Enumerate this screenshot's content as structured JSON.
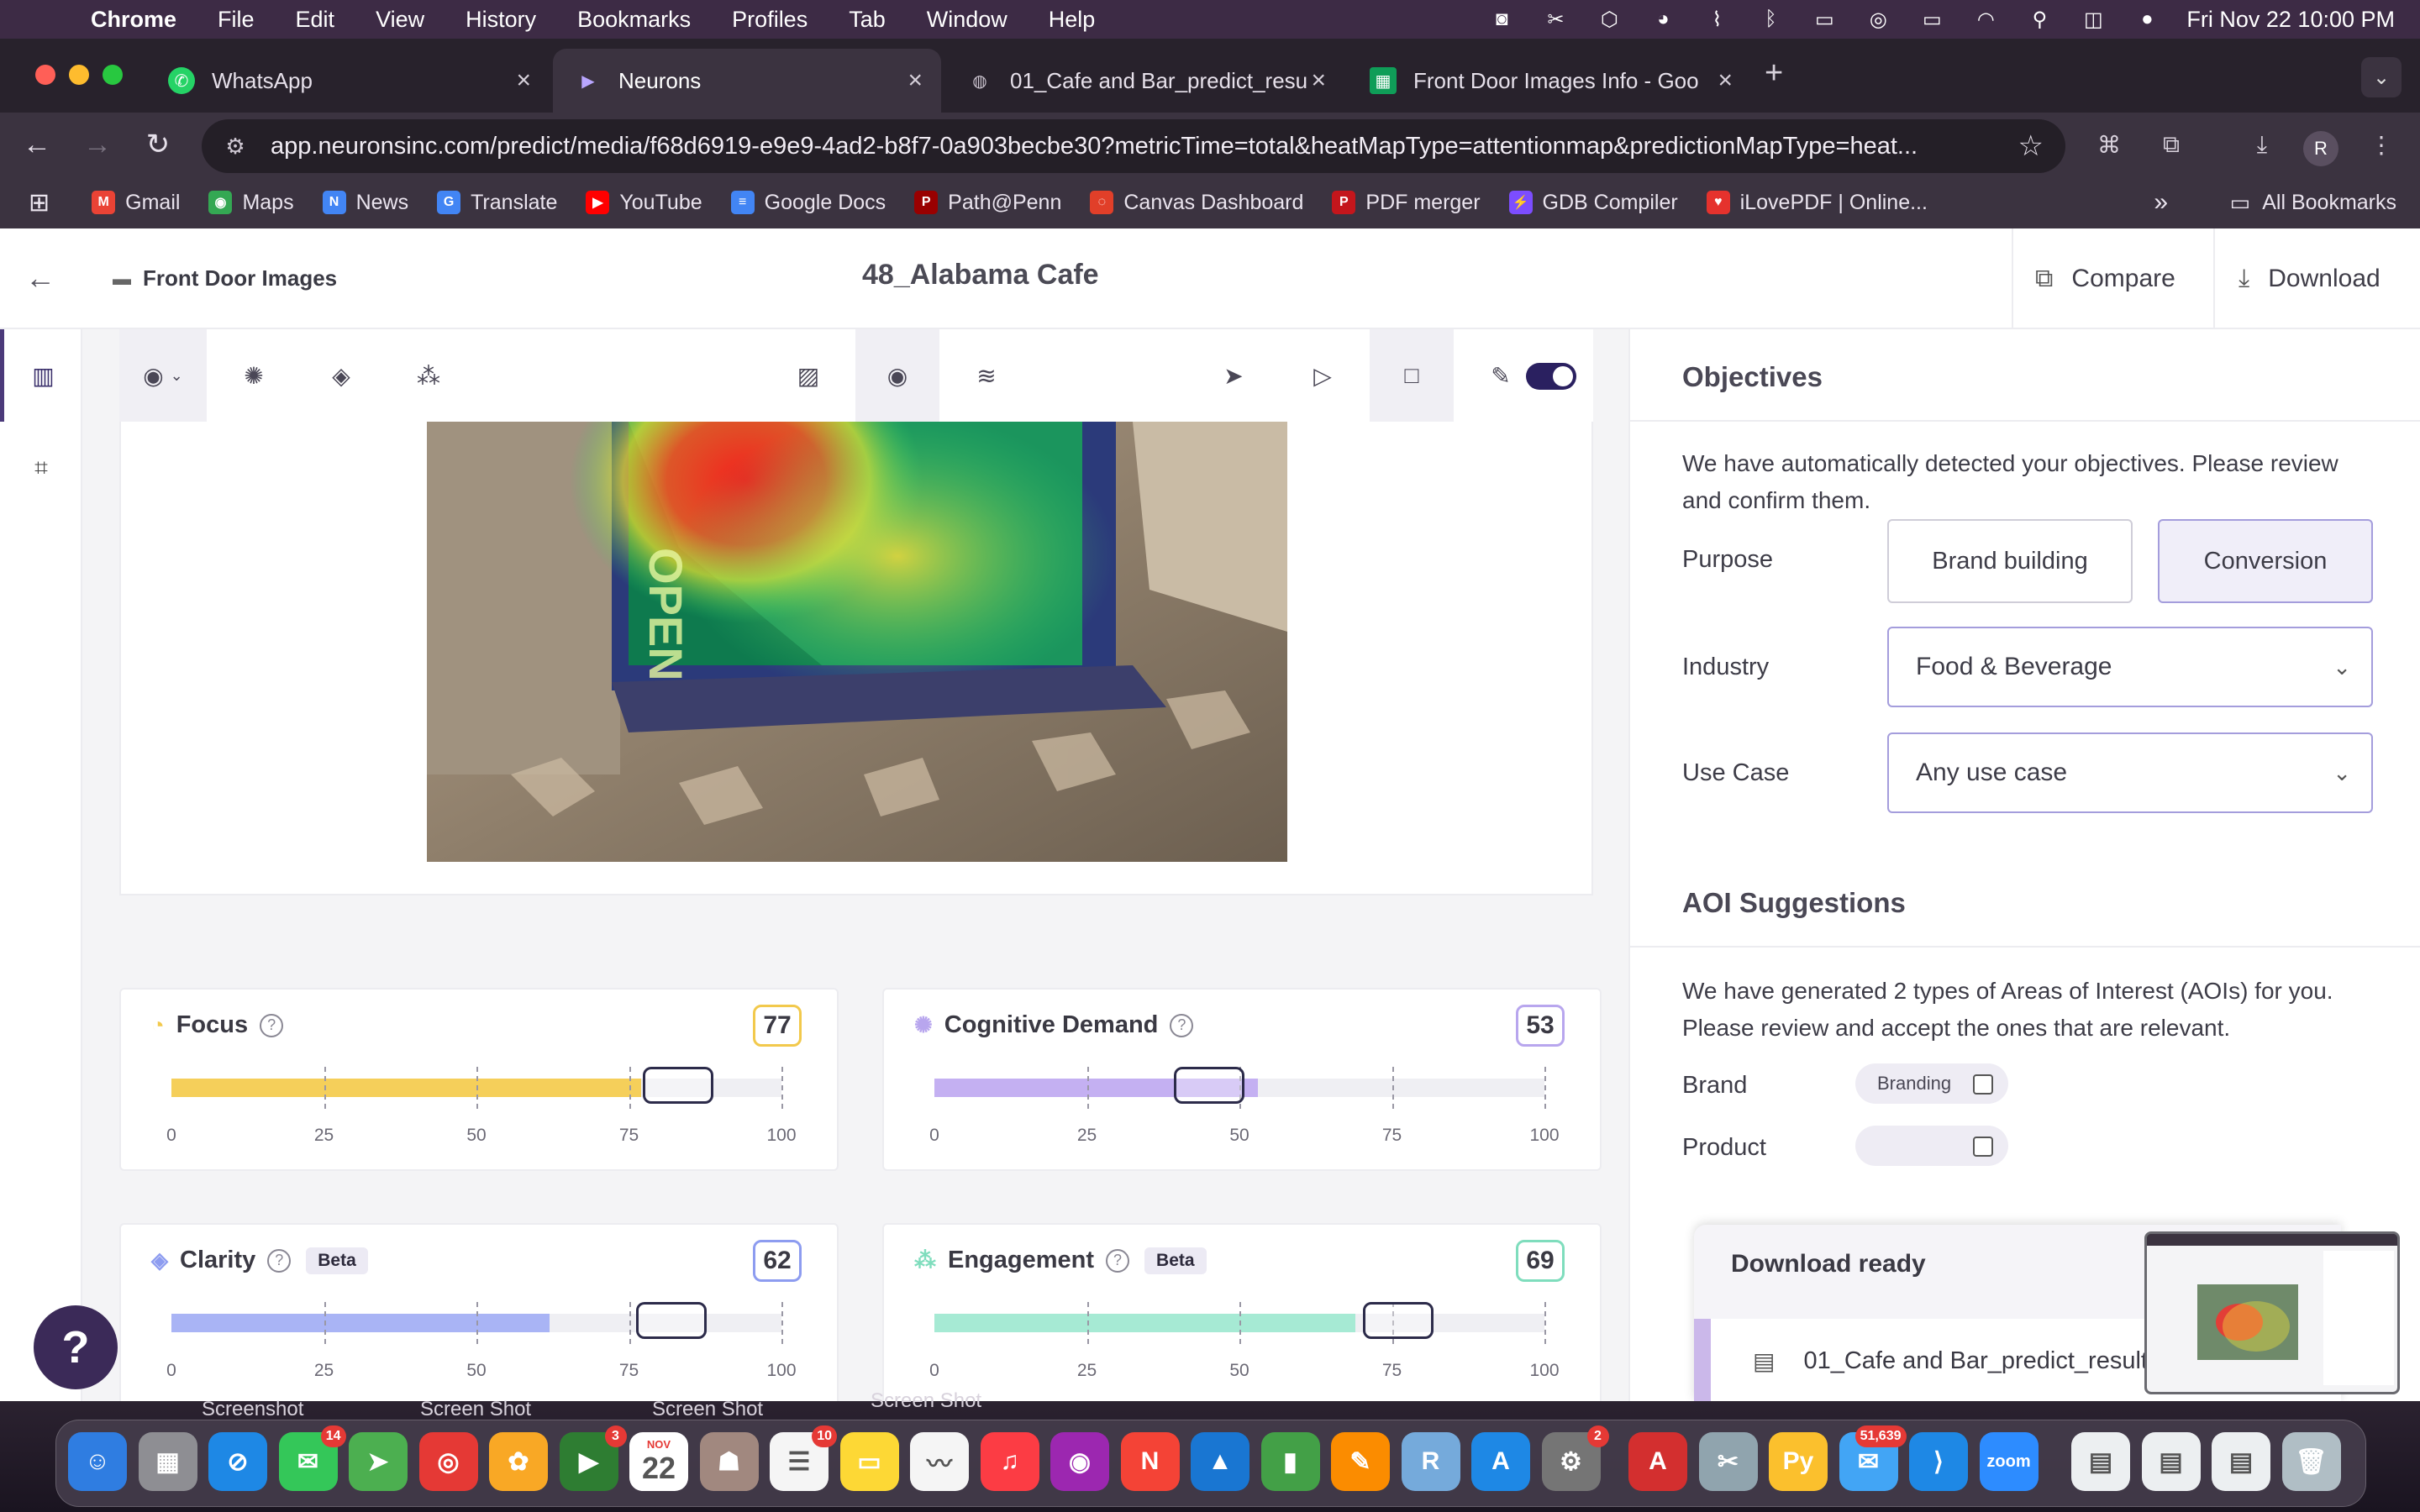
{
  "menubar": {
    "app": "Chrome",
    "items": [
      "File",
      "Edit",
      "View",
      "History",
      "Bookmarks",
      "Profiles",
      "Tab",
      "Window",
      "Help"
    ],
    "clock": "Fri Nov 22  10:00 PM"
  },
  "tabs": [
    {
      "title": "WhatsApp",
      "color": "#25d366"
    },
    {
      "title": "Neurons",
      "color": "#8b5cf6"
    },
    {
      "title": "01_Cafe and Bar_predict_resu",
      "color": "#9aa0a6"
    },
    {
      "title": "Front Door Images Info - Goo",
      "color": "#0f9d58"
    }
  ],
  "omnibox": {
    "url": "app.neuronsinc.com/predict/media/f68d6919-e9e9-4ad2-b8f7-0a903becbe30?metricTime=total&heatMapType=attentionmap&predictionMapType=heat..."
  },
  "profile_initial": "R",
  "bookmarks": [
    {
      "label": "Gmail",
      "color": "#ea4335",
      "glyph": "M"
    },
    {
      "label": "Maps",
      "color": "#34a853",
      "glyph": "◉"
    },
    {
      "label": "News",
      "color": "#4285f4",
      "glyph": "N"
    },
    {
      "label": "Translate",
      "color": "#4285f4",
      "glyph": "G"
    },
    {
      "label": "YouTube",
      "color": "#ff0000",
      "glyph": "▶"
    },
    {
      "label": "Google Docs",
      "color": "#4285f4",
      "glyph": "≡"
    },
    {
      "label": "Path@Penn",
      "color": "#990000",
      "glyph": "P"
    },
    {
      "label": "Canvas Dashboard",
      "color": "#e13f29",
      "glyph": "◌"
    },
    {
      "label": "PDF merger",
      "color": "#c4161c",
      "glyph": "P"
    },
    {
      "label": "GDB Compiler",
      "color": "#7c4dff",
      "glyph": "⚡"
    },
    {
      "label": "iLovePDF | Online...",
      "color": "#e5322d",
      "glyph": "♥"
    }
  ],
  "bookmarks_all": "All Bookmarks",
  "app": {
    "folder": "Front Door Images",
    "title": "48_Alabama Cafe",
    "compare": "Compare",
    "download": "Download"
  },
  "metrics": [
    {
      "name": "Focus",
      "score": "77",
      "value": 77,
      "marker": 83,
      "beta": "",
      "fill": "#f5cf5a",
      "border": "#f2c94c",
      "icon": "drop-icon",
      "glyph": "◔"
    },
    {
      "name": "Cognitive Demand",
      "score": "53",
      "value": 53,
      "marker": 45,
      "beta": "",
      "fill": "#c4b0f2",
      "border": "#b8a6ee",
      "icon": "brain-icon",
      "glyph": "✺"
    },
    {
      "name": "Clarity",
      "score": "62",
      "value": 62,
      "marker": 82,
      "beta": "Beta",
      "fill": "#a9b4f5",
      "border": "#8d9cf0",
      "icon": "diamond-icon",
      "glyph": "◈"
    },
    {
      "name": "Engagement",
      "score": "69",
      "value": 69,
      "marker": 76,
      "beta": "Beta",
      "fill": "#a6ead4",
      "border": "#7fddbd",
      "icon": "engagement-icon",
      "glyph": "⁂"
    }
  ],
  "axis_ticks": [
    "0",
    "25",
    "50",
    "75",
    "100"
  ],
  "objectives": {
    "title": "Objectives",
    "intro": "We have automatically detected your objectives. Please review and confirm them.",
    "purpose_label": "Purpose",
    "purpose_options": [
      "Brand building",
      "Conversion"
    ],
    "industry_label": "Industry",
    "industry_value": "Food & Beverage",
    "usecase_label": "Use Case",
    "usecase_value": "Any use case"
  },
  "aoi": {
    "title": "AOI Suggestions",
    "intro": "We have generated 2 types of Areas of Interest (AOIs) for you. Please review and accept the ones that are relevant.",
    "brand_label": "Brand",
    "brand_chip": "Branding",
    "product_label": "Product"
  },
  "download_popup": {
    "title": "Download ready",
    "file": "01_Cafe and Bar_predict_result"
  },
  "desktop_labels": [
    "Screenshot",
    "Screen Shot",
    "Screen Shot",
    "Screen Shot"
  ],
  "dock": [
    {
      "name": "finder",
      "color": "#2f7de1",
      "glyph": "☺"
    },
    {
      "name": "launchpad",
      "color": "#8e8e93",
      "glyph": "▦"
    },
    {
      "name": "safari",
      "color": "#1e88e5",
      "glyph": "⊘"
    },
    {
      "name": "messages",
      "color": "#34c759",
      "glyph": "✉",
      "badge": "14"
    },
    {
      "name": "maps",
      "color": "#4caf50",
      "glyph": "➤"
    },
    {
      "name": "chrome",
      "color": "#e53935",
      "glyph": "◎"
    },
    {
      "name": "photos",
      "color": "#f9a825",
      "glyph": "✿"
    },
    {
      "name": "facetime",
      "color": "#2e7d32",
      "glyph": "▶",
      "badge": "3"
    },
    {
      "name": "calendar",
      "color": "#ffffff",
      "glyph": "22",
      "month": "NOV"
    },
    {
      "name": "contacts",
      "color": "#a1887f",
      "glyph": "☗"
    },
    {
      "name": "reminders",
      "color": "#f5f5f5",
      "glyph": "☰",
      "badge": "10"
    },
    {
      "name": "notes",
      "color": "#fdd835",
      "glyph": "▭"
    },
    {
      "name": "freeform",
      "color": "#f5f5f5",
      "glyph": "〰"
    },
    {
      "name": "music",
      "color": "#fc3c44",
      "glyph": "♫"
    },
    {
      "name": "podcasts",
      "color": "#9c27b0",
      "glyph": "◉"
    },
    {
      "name": "news",
      "color": "#f44336",
      "glyph": "N"
    },
    {
      "name": "keynote",
      "color": "#1976d2",
      "glyph": "▲"
    },
    {
      "name": "numbers",
      "color": "#43a047",
      "glyph": "▮"
    },
    {
      "name": "pages",
      "color": "#fb8c00",
      "glyph": "✎"
    },
    {
      "name": "rstudio",
      "color": "#75aadb",
      "glyph": "R"
    },
    {
      "name": "app-store",
      "color": "#1e88e5",
      "glyph": "A"
    },
    {
      "name": "system-settings",
      "color": "#757575",
      "glyph": "⚙",
      "badge": "2"
    },
    {
      "name": "acrobat",
      "color": "#d32f2f",
      "glyph": "A"
    },
    {
      "name": "screenshot-tool",
      "color": "#90a4ae",
      "glyph": "✂"
    },
    {
      "name": "python",
      "color": "#fbc02d",
      "glyph": "Py"
    },
    {
      "name": "mail",
      "color": "#42a5f5",
      "glyph": "✉",
      "badge": "51,639"
    },
    {
      "name": "vscode",
      "color": "#1e88e5",
      "glyph": "⟩"
    },
    {
      "name": "zoom",
      "color": "#2d8cff",
      "glyph": "zoom"
    },
    {
      "name": "recent-doc-1",
      "color": "#eceff1",
      "glyph": "▤"
    },
    {
      "name": "recent-doc-2",
      "color": "#eceff1",
      "glyph": "▤"
    },
    {
      "name": "recent-doc-3",
      "color": "#eceff1",
      "glyph": "▤"
    },
    {
      "name": "trash",
      "color": "#b0bec5",
      "glyph": "🗑"
    }
  ]
}
